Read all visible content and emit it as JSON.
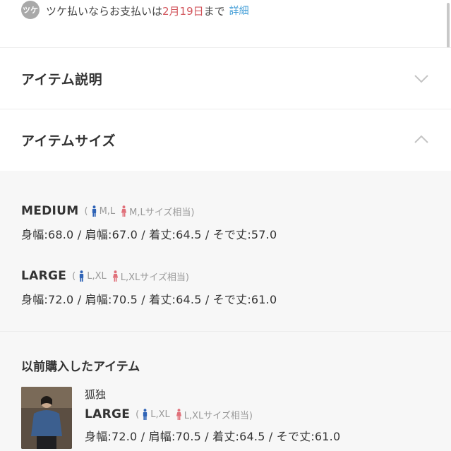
{
  "payment": {
    "badge": "ツケ",
    "text_before": "ツケ払いならお支払いは",
    "date": "2月19日",
    "text_after": "まで",
    "link": "詳細"
  },
  "sections": {
    "item_description": "アイテム説明",
    "item_size": "アイテムサイズ"
  },
  "sizes": [
    {
      "name": "MEDIUM",
      "open_paren": "(",
      "male_fit": "M,L",
      "female_fit": "M,Lサイズ相当)",
      "measurements": "身幅:68.0 / 肩幅:67.0 / 着丈:64.5 / そで丈:57.0"
    },
    {
      "name": "LARGE",
      "open_paren": "(",
      "male_fit": "L,XL",
      "female_fit": "L,XLサイズ相当)",
      "measurements": "身幅:72.0 / 肩幅:70.5 / 着丈:64.5 / そで丈:61.0"
    }
  ],
  "previous": {
    "title": "以前購入したアイテム",
    "item_name": "狐独",
    "size_name": "LARGE",
    "open_paren": "(",
    "male_fit": "L,XL",
    "female_fit": "L,XLサイズ相当)",
    "measurements": "身幅:72.0 / 肩幅:70.5 / 着丈:64.5 / そで丈:61.0"
  },
  "colors": {
    "male_icon": "#2f63b6",
    "female_icon": "#e0707a",
    "accent_date": "#d2555c",
    "link": "#3d9bd6"
  }
}
